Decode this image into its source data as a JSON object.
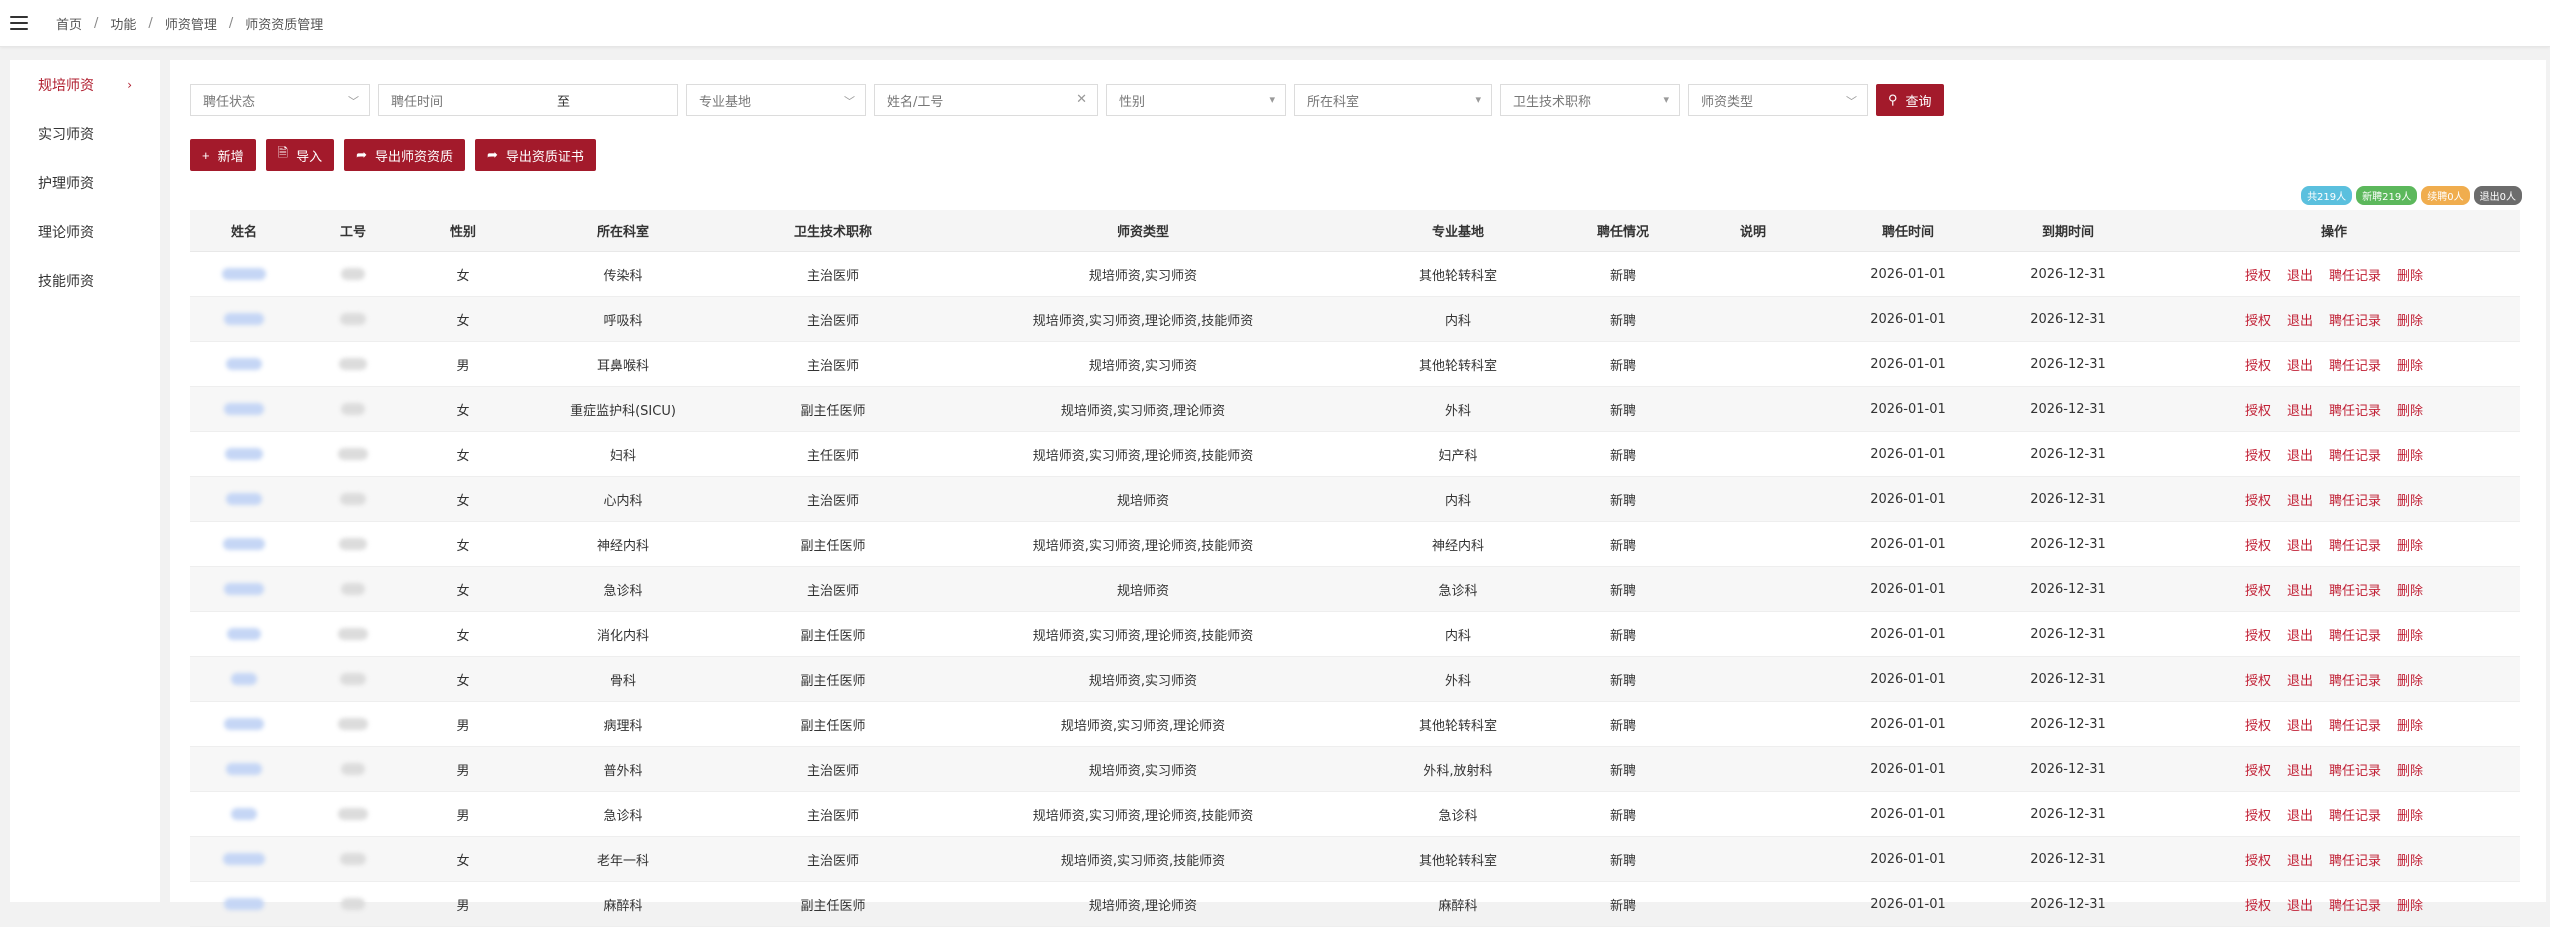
{
  "breadcrumb": [
    "首页",
    "功能",
    "师资管理",
    "师资资质管理"
  ],
  "sidebar": {
    "items": [
      {
        "label": "规培师资",
        "active": true
      },
      {
        "label": "实习师资",
        "active": false
      },
      {
        "label": "护理师资",
        "active": false
      },
      {
        "label": "理论师资",
        "active": false
      },
      {
        "label": "技能师资",
        "active": false
      }
    ],
    "active_chevron": "›"
  },
  "filters": {
    "status": "聘任状态",
    "time": "聘任时间",
    "time_to": "至",
    "base": "专业基地",
    "name_id": "姓名/工号",
    "gender": "性别",
    "dept": "所在科室",
    "title": "卫生技术职称",
    "type": "师资类型",
    "query_label": "查询"
  },
  "actions": {
    "add": "新增",
    "import": "导入",
    "export_quality": "导出师资资质",
    "export_cert": "导出资质证书"
  },
  "badges": [
    "共219人",
    "新聘219人",
    "续聘0人",
    "退出0人"
  ],
  "table": {
    "headers": [
      "姓名",
      "工号",
      "性别",
      "所在科室",
      "卫生技术职称",
      "师资类型",
      "专业基地",
      "聘任情况",
      "说明",
      "聘任时间",
      "到期时间",
      "操作"
    ],
    "op_labels": [
      "授权",
      "退出",
      "聘任记录",
      "删除"
    ],
    "rows": [
      {
        "gender": "女",
        "dept": "传染科",
        "title": "主治医师",
        "type": "规培师资,实习师资",
        "base": "其他轮转科室",
        "status": "新聘",
        "note": "",
        "start": "2026-01-01",
        "end": "2026-12-31"
      },
      {
        "gender": "女",
        "dept": "呼吸科",
        "title": "主治医师",
        "type": "规培师资,实习师资,理论师资,技能师资",
        "base": "内科",
        "status": "新聘",
        "note": "",
        "start": "2026-01-01",
        "end": "2026-12-31"
      },
      {
        "gender": "男",
        "dept": "耳鼻喉科",
        "title": "主治医师",
        "type": "规培师资,实习师资",
        "base": "其他轮转科室",
        "status": "新聘",
        "note": "",
        "start": "2026-01-01",
        "end": "2026-12-31"
      },
      {
        "gender": "女",
        "dept": "重症监护科(SICU)",
        "title": "副主任医师",
        "type": "规培师资,实习师资,理论师资",
        "base": "外科",
        "status": "新聘",
        "note": "",
        "start": "2026-01-01",
        "end": "2026-12-31"
      },
      {
        "gender": "女",
        "dept": "妇科",
        "title": "主任医师",
        "type": "规培师资,实习师资,理论师资,技能师资",
        "base": "妇产科",
        "status": "新聘",
        "note": "",
        "start": "2026-01-01",
        "end": "2026-12-31"
      },
      {
        "gender": "女",
        "dept": "心内科",
        "title": "主治医师",
        "type": "规培师资",
        "base": "内科",
        "status": "新聘",
        "note": "",
        "start": "2026-01-01",
        "end": "2026-12-31"
      },
      {
        "gender": "女",
        "dept": "神经内科",
        "title": "副主任医师",
        "type": "规培师资,实习师资,理论师资,技能师资",
        "base": "神经内科",
        "status": "新聘",
        "note": "",
        "start": "2026-01-01",
        "end": "2026-12-31"
      },
      {
        "gender": "女",
        "dept": "急诊科",
        "title": "主治医师",
        "type": "规培师资",
        "base": "急诊科",
        "status": "新聘",
        "note": "",
        "start": "2026-01-01",
        "end": "2026-12-31"
      },
      {
        "gender": "女",
        "dept": "消化内科",
        "title": "副主任医师",
        "type": "规培师资,实习师资,理论师资,技能师资",
        "base": "内科",
        "status": "新聘",
        "note": "",
        "start": "2026-01-01",
        "end": "2026-12-31"
      },
      {
        "gender": "女",
        "dept": "骨科",
        "title": "副主任医师",
        "type": "规培师资,实习师资",
        "base": "外科",
        "status": "新聘",
        "note": "",
        "start": "2026-01-01",
        "end": "2026-12-31"
      },
      {
        "gender": "男",
        "dept": "病理科",
        "title": "副主任医师",
        "type": "规培师资,实习师资,理论师资",
        "base": "其他轮转科室",
        "status": "新聘",
        "note": "",
        "start": "2026-01-01",
        "end": "2026-12-31"
      },
      {
        "gender": "男",
        "dept": "普外科",
        "title": "主治医师",
        "type": "规培师资,实习师资",
        "base": "外科,放射科",
        "status": "新聘",
        "note": "",
        "start": "2026-01-01",
        "end": "2026-12-31"
      },
      {
        "gender": "男",
        "dept": "急诊科",
        "title": "主治医师",
        "type": "规培师资,实习师资,理论师资,技能师资",
        "base": "急诊科",
        "status": "新聘",
        "note": "",
        "start": "2026-01-01",
        "end": "2026-12-31"
      },
      {
        "gender": "女",
        "dept": "老年一科",
        "title": "主治医师",
        "type": "规培师资,实习师资,技能师资",
        "base": "其他轮转科室",
        "status": "新聘",
        "note": "",
        "start": "2026-01-01",
        "end": "2026-12-31"
      },
      {
        "gender": "男",
        "dept": "麻醉科",
        "title": "副主任医师",
        "type": "规培师资,理论师资",
        "base": "麻醉科",
        "status": "新聘",
        "note": "",
        "start": "2026-01-01",
        "end": "2026-12-31"
      }
    ]
  }
}
